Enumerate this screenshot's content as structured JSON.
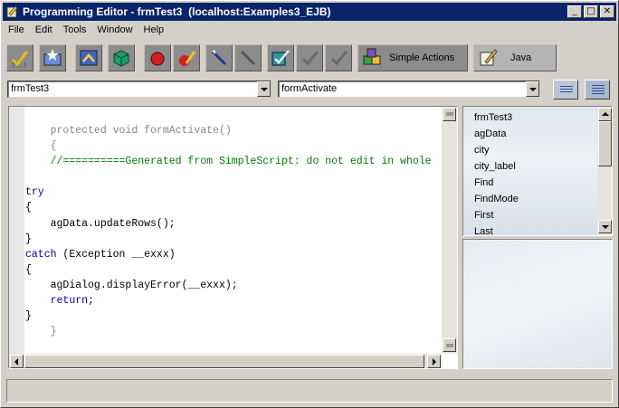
{
  "window": {
    "title": "Programming Editor - frmTest3  (localhost:Examples3_EJB)",
    "min_glyph": "_",
    "max_glyph": "□",
    "close_glyph": "✕"
  },
  "menu": [
    "File",
    "Edit",
    "Tools",
    "Window",
    "Help"
  ],
  "toolbar": {
    "simple_actions_label": "Simple Actions",
    "java_label": "Java"
  },
  "selectors": {
    "object": "frmTest3",
    "method": "formActivate"
  },
  "code_lines": [
    {
      "indent": "    ",
      "text": "protected void formActivate()",
      "style": "dim"
    },
    {
      "indent": "    ",
      "text": "{",
      "style": "dim"
    },
    {
      "indent": "    ",
      "text": "//==========Generated from SimpleScript: do not edit in whole",
      "style": "cm"
    },
    {
      "indent": "",
      "text": "",
      "style": ""
    },
    {
      "indent": "",
      "text": "try",
      "style": "kw"
    },
    {
      "indent": "",
      "text": "{",
      "style": ""
    },
    {
      "indent": "    ",
      "text": "agData.updateRows();",
      "style": ""
    },
    {
      "indent": "",
      "text": "}",
      "style": ""
    },
    {
      "indent": "",
      "text": "catch",
      "style": "kw",
      "rest": " (Exception __exxx)"
    },
    {
      "indent": "",
      "text": "{",
      "style": ""
    },
    {
      "indent": "    ",
      "text": "agDialog.displayError(__exxx);",
      "style": ""
    },
    {
      "indent": "    ",
      "text": "return",
      "style": "kw",
      "rest": ";"
    },
    {
      "indent": "",
      "text": "}",
      "style": ""
    },
    {
      "indent": "    ",
      "text": "}",
      "style": "dim"
    }
  ],
  "members": [
    "frmTest3",
    "agData",
    "city",
    "city_label",
    "Find",
    "FindMode",
    "First",
    "Last"
  ],
  "colors": {
    "titlebar": "#0a246a",
    "keyword": "#0000a0",
    "comment": "#008000",
    "generated": "#888888"
  }
}
